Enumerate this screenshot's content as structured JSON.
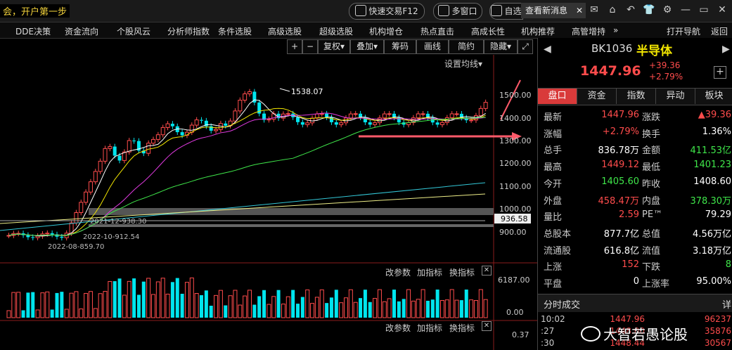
{
  "titlebar": {
    "title": "会，开户第一步",
    "quick_trade": "快速交易F12",
    "multi_window": "多窗口",
    "self_select": "自选",
    "news": "查看新消息"
  },
  "menu": [
    "DDE决策",
    "资金流向",
    "个股风云",
    "分析师指数",
    "条件选股",
    "高级选股",
    "超级选股",
    "机构增仓",
    "热点直击",
    "高成长性",
    "机构推荐",
    "高管增持"
  ],
  "menu_right": [
    "打开导航",
    "返回"
  ],
  "toolbar": {
    "plus": "+",
    "minus": "−",
    "restore": "复权",
    "overlay": "叠加",
    "chips": "筹码",
    "draw": "画线",
    "simple": "简约",
    "hide": "隐藏"
  },
  "chart": {
    "ma_setting": "设置均线",
    "y_ticks": [
      "1500.00",
      "1400.00",
      "1300.00",
      "1200.00",
      "1100.00",
      "1000.00",
      "936.58",
      "900.00"
    ],
    "annotations": {
      "high": "1538.07",
      "low1": "2021-12-938.30",
      "low2": "2022-10-912.54",
      "low3": "2022-08-859.70"
    },
    "vol_panel": {
      "change_param": "改参数",
      "add_indicator": "加指标",
      "switch_indicator": "换指标",
      "y_top": "6187.00",
      "y_bottom": "0.00"
    },
    "ind_panel": {
      "change_param": "改参数",
      "add_indicator": "加指标",
      "switch_indicator": "换指标",
      "y_value": "0.37"
    }
  },
  "stock": {
    "code": "BK1036",
    "name": "半导体",
    "price": "1447.96",
    "change": "+39.36",
    "change_pct": "+2.79%"
  },
  "tabs": [
    "盘口",
    "资金",
    "指数",
    "异动",
    "板块"
  ],
  "quote_rows": [
    {
      "l1": "最新",
      "v1": "1447.96",
      "c1": "red",
      "l2": "涨跌",
      "v2": "▲39.36",
      "c2": "red"
    },
    {
      "l1": "涨幅",
      "v1": "+2.79%",
      "c1": "red",
      "l2": "换手",
      "v2": "1.36%",
      "c2": "white"
    },
    {
      "l1": "总手",
      "v1": "836.78万",
      "c1": "white",
      "l2": "金额",
      "v2": "411.53亿",
      "c2": "green"
    },
    {
      "l1": "最高",
      "v1": "1449.12",
      "c1": "red",
      "l2": "最低",
      "v2": "1401.23",
      "c2": "green"
    },
    {
      "l1": "今开",
      "v1": "1405.60",
      "c1": "green",
      "l2": "昨收",
      "v2": "1408.60",
      "c2": "white"
    },
    {
      "l1": "外盘",
      "v1": "458.47万",
      "c1": "red",
      "l2": "内盘",
      "v2": "378.30万",
      "c2": "green"
    },
    {
      "l1": "量比",
      "v1": "2.59",
      "c1": "red",
      "l2": "PE™",
      "v2": "79.29",
      "c2": "white"
    },
    {
      "l1": "总股本",
      "v1": "877.7亿",
      "c1": "white",
      "l2": "总值",
      "v2": "4.56万亿",
      "c2": "white"
    },
    {
      "l1": "流通股",
      "v1": "616.8亿",
      "c1": "white",
      "l2": "流值",
      "v2": "3.18万亿",
      "c2": "white"
    },
    {
      "l1": "上涨",
      "v1": "152",
      "c1": "red",
      "l2": "下跌",
      "v2": "8",
      "c2": "green"
    },
    {
      "l1": "平盘",
      "v1": "0",
      "c1": "white",
      "l2": "上涨率",
      "v2": "95.00%",
      "c2": "white"
    }
  ],
  "ticks": {
    "title": "分时成交",
    "detail": "详",
    "rows": [
      {
        "t": "10:02",
        "p": "1447.96",
        "v": "96237"
      },
      {
        "t": ":27",
        "p": "1448.00",
        "v": "35876"
      },
      {
        "t": ":30",
        "p": "1448.44",
        "v": "30567"
      }
    ]
  },
  "watermark": "大智若愚论股",
  "colors": {
    "up": "#ff4c4c",
    "down": "#00e5ee",
    "ma5": "#ffffff",
    "ma10": "#f2e600",
    "ma20": "#e03ae0",
    "ma60": "#3fe64a"
  }
}
